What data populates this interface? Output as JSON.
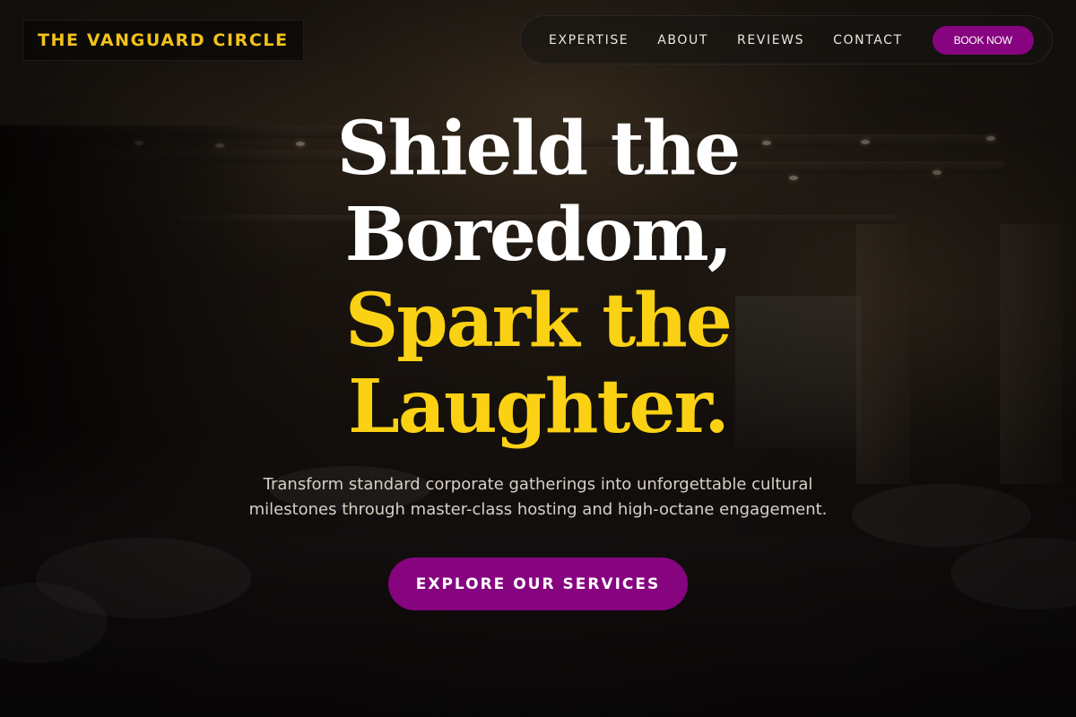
{
  "header": {
    "brand": "THE VANGUARD CIRCLE",
    "nav": {
      "expertise": "EXPERTISE",
      "about": "ABOUT",
      "reviews": "REVIEWS",
      "contact": "CONTACT",
      "book_now": "BOOK NOW"
    }
  },
  "hero": {
    "title_line1": "Shield the",
    "title_line2": "Boredom,",
    "title_line3": "Spark the",
    "title_line4": "Laughter.",
    "subtitle": "Transform standard corporate gatherings into unforgettable cultural milestones through master-class hosting and high-octane engagement.",
    "cta_label": "EXPLORE OUR SERVICES"
  },
  "colors": {
    "accent_gold": "#fbd114",
    "brand_purple": "#86047f"
  }
}
